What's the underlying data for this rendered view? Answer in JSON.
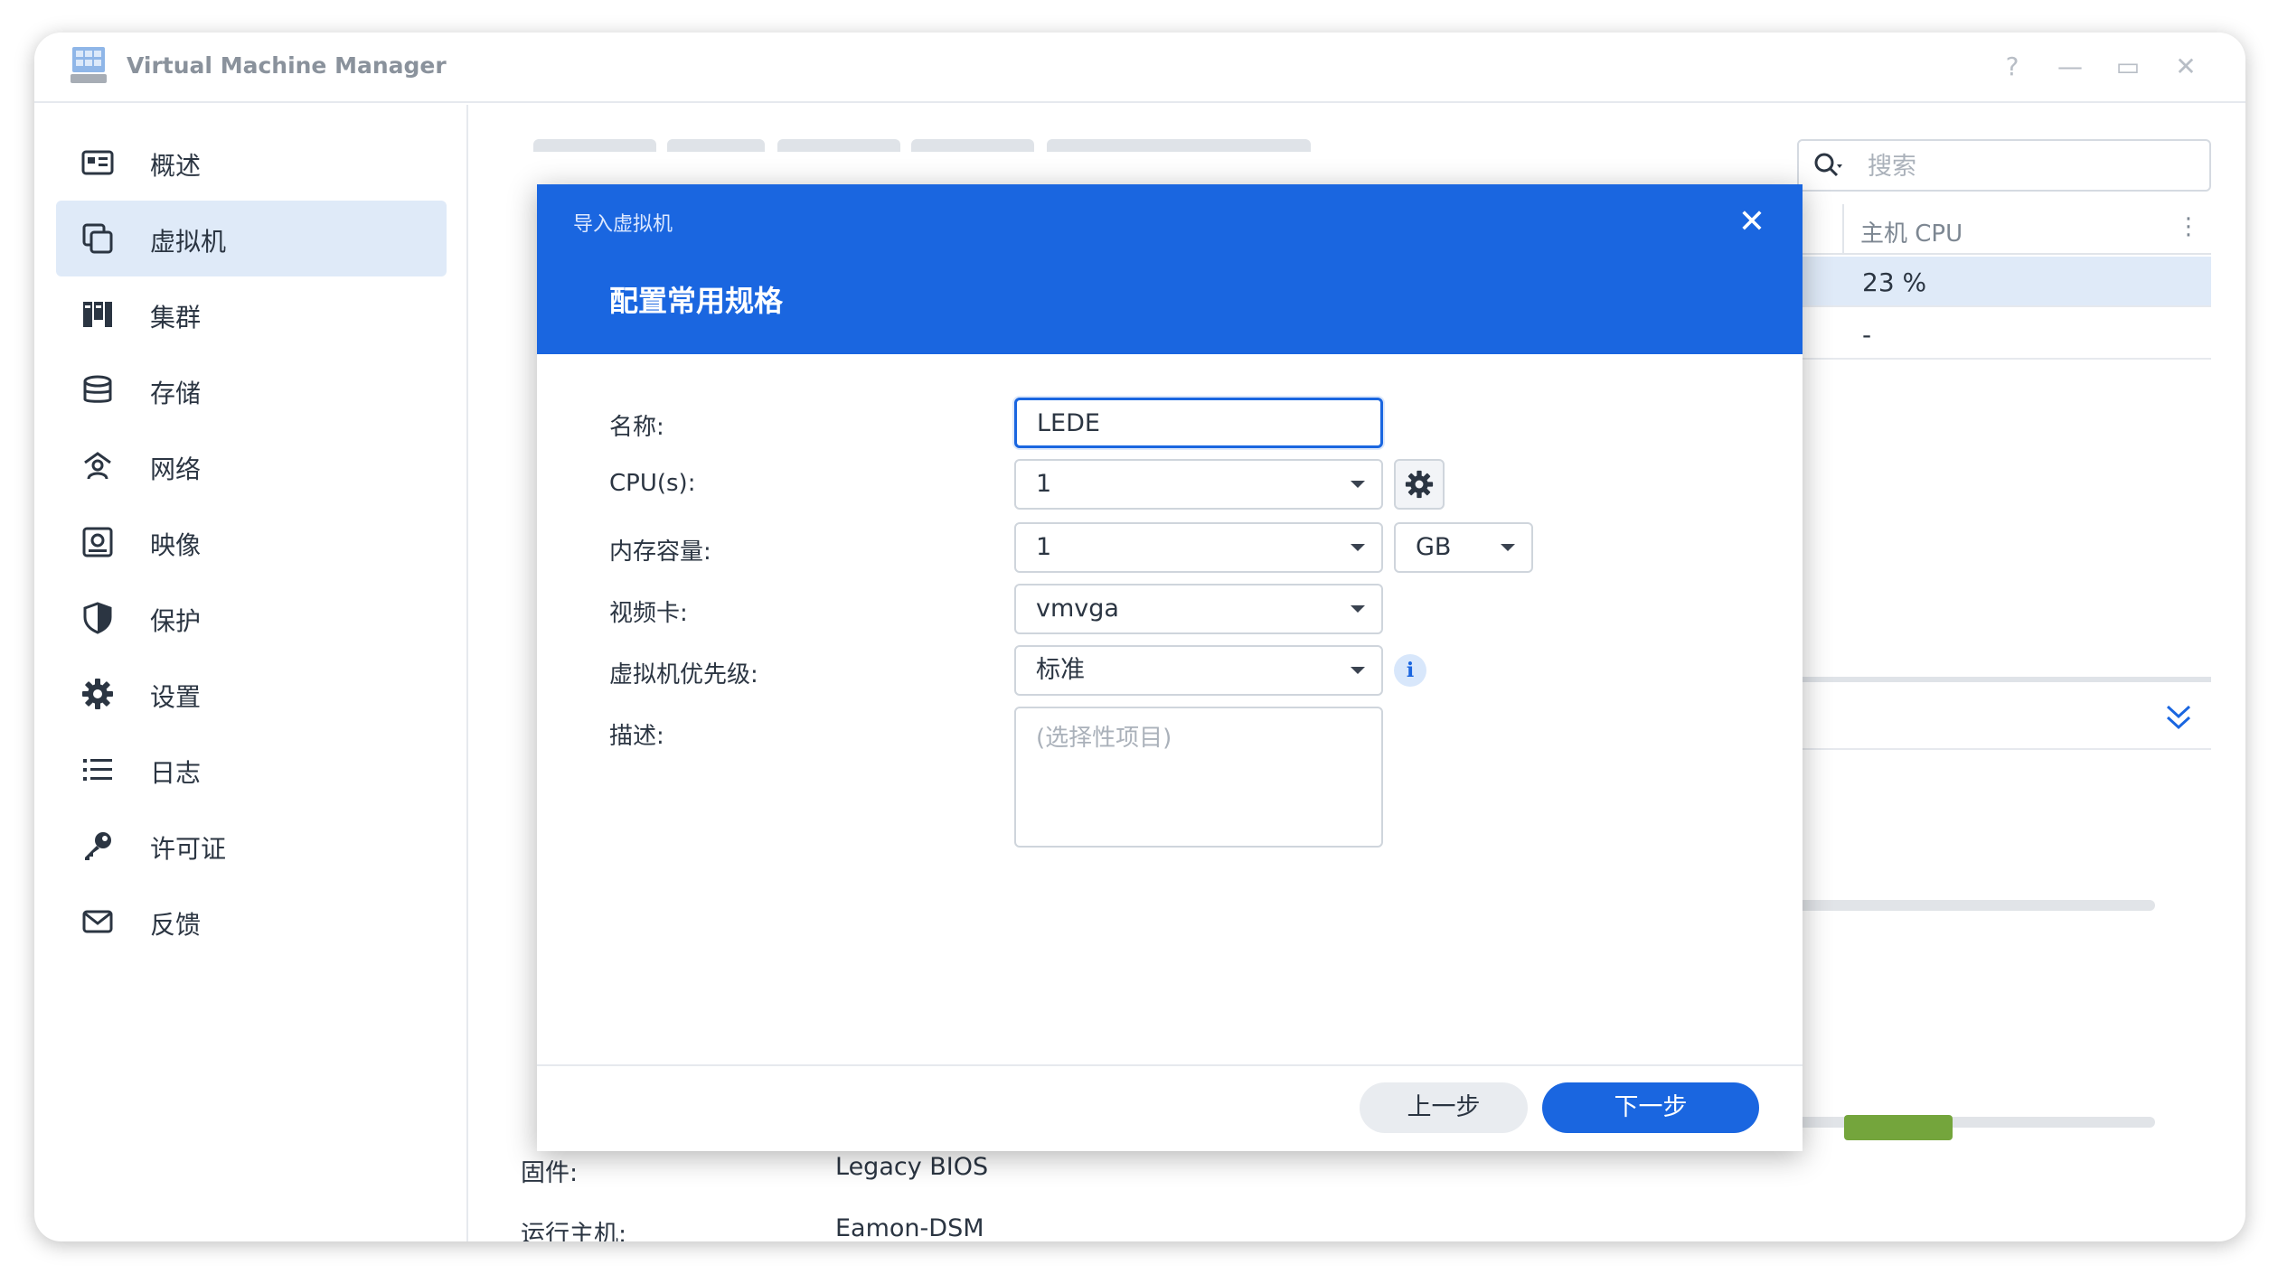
{
  "app": {
    "title": "Virtual Machine Manager",
    "controls": [
      "?",
      "—",
      "▭",
      "✕"
    ]
  },
  "sidebar": {
    "items": [
      {
        "label": "概述",
        "icon": "overview-icon"
      },
      {
        "label": "虚拟机",
        "icon": "virtual-machine-icon",
        "active": true
      },
      {
        "label": "集群",
        "icon": "cluster-icon"
      },
      {
        "label": "存储",
        "icon": "storage-icon"
      },
      {
        "label": "网络",
        "icon": "network-icon"
      },
      {
        "label": "映像",
        "icon": "image-icon"
      },
      {
        "label": "保护",
        "icon": "shield-icon"
      },
      {
        "label": "设置",
        "icon": "gear-icon"
      },
      {
        "label": "日志",
        "icon": "list-icon"
      },
      {
        "label": "许可证",
        "icon": "key-icon"
      },
      {
        "label": "反馈",
        "icon": "mail-icon"
      }
    ]
  },
  "main": {
    "search_placeholder": "搜索",
    "column_header": "主机 CPU",
    "more_glyph": "⋮",
    "rows": [
      "23 %",
      "-"
    ],
    "details": [
      {
        "label": "固件:",
        "value": "Legacy BIOS"
      },
      {
        "label": "运行主机:",
        "value": "Eamon-DSM"
      }
    ],
    "usage_bars": [
      0,
      0.27
    ]
  },
  "dialog": {
    "title": "导入虚拟机",
    "subtitle": "配置常用规格",
    "close": "✕",
    "fields": {
      "name_label": "名称:",
      "name_value": "LEDE",
      "cpu_label": "CPU(s):",
      "cpu_value": "1",
      "memory_label": "内存容量:",
      "memory_value": "1",
      "memory_unit": "GB",
      "video_label": "视频卡:",
      "video_value": "vmvga",
      "priority_label": "虚拟机优先级:",
      "priority_value": "标准",
      "description_label": "描述:",
      "description_placeholder": "(选择性项目)"
    },
    "info_glyph": "i",
    "prev_label": "上一步",
    "next_label": "下一步"
  },
  "colors": {
    "accent": "#1a66e0",
    "active_nav": "#dfeaf8",
    "usage_bar": "#1d7a2c"
  }
}
